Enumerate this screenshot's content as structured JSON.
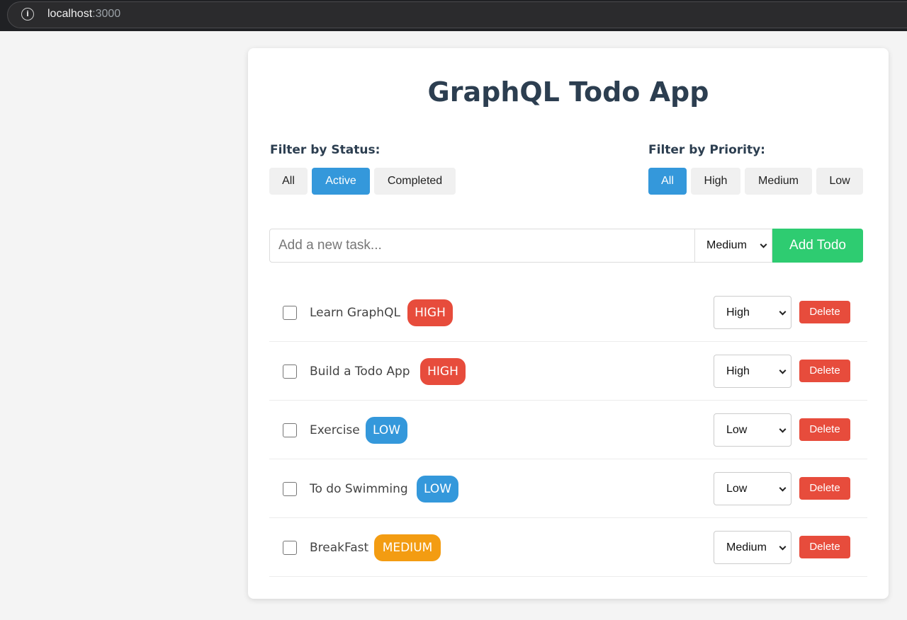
{
  "browser": {
    "host": "localhost",
    "port": ":3000"
  },
  "app": {
    "title": "GraphQL Todo App"
  },
  "filters": {
    "status": {
      "label": "Filter by Status:",
      "options": [
        "All",
        "Active",
        "Completed"
      ],
      "selected": "Active"
    },
    "priority": {
      "label": "Filter by Priority:",
      "options": [
        "All",
        "High",
        "Medium",
        "Low"
      ],
      "selected": "All"
    }
  },
  "add_form": {
    "placeholder": "Add a new task...",
    "priority_value": "Medium",
    "button_label": "Add Todo"
  },
  "todos": [
    {
      "text": "Learn GraphQL",
      "badge": "HIGH",
      "priority": "High",
      "completed": false
    },
    {
      "text": "Build a Todo App",
      "badge": "HIGH",
      "priority": "High",
      "completed": false
    },
    {
      "text": "Exercise",
      "badge": "LOW",
      "priority": "Low",
      "completed": false
    },
    {
      "text": "To do Swimming",
      "badge": "LOW",
      "priority": "Low",
      "completed": false
    },
    {
      "text": "BreakFast",
      "badge": "MEDIUM",
      "priority": "Medium",
      "completed": false
    }
  ],
  "delete_label": "Delete",
  "colors": {
    "active": "#3498db",
    "add_button": "#2ecc71",
    "delete": "#e74c3c",
    "high": "#e74c3c",
    "medium": "#f39c12",
    "low": "#3498db",
    "title": "#2c3e50"
  }
}
